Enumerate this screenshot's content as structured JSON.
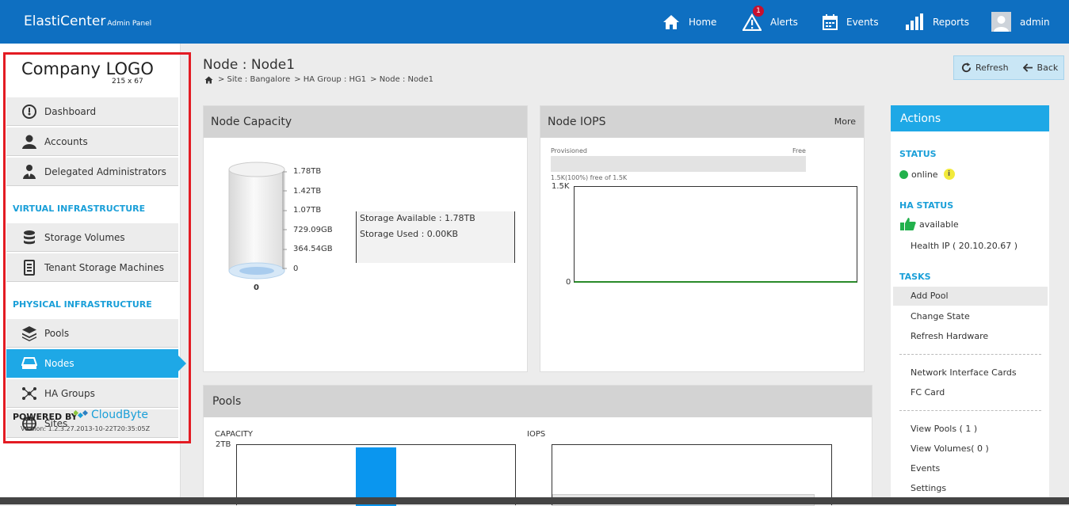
{
  "header": {
    "brand": "ElastiCenter",
    "brand_sub": "Admin Panel",
    "nav": [
      {
        "label": "Home",
        "icon": "home-icon"
      },
      {
        "label": "Alerts",
        "icon": "alert-icon",
        "badge": "1"
      },
      {
        "label": "Events",
        "icon": "calendar-icon"
      },
      {
        "label": "Reports",
        "icon": "bar-chart-icon"
      },
      {
        "label": "admin",
        "icon": "user-avatar-icon"
      }
    ]
  },
  "sidebar": {
    "logo": "Company LOGO",
    "logo_size": "215 x 67",
    "items": [
      {
        "label": "Dashboard",
        "icon": "dashboard-icon"
      },
      {
        "label": "Accounts",
        "icon": "user-icon"
      },
      {
        "label": "Delegated Administrators",
        "icon": "admin-icon"
      }
    ],
    "section_virtual": "VIRTUAL INFRASTRUCTURE",
    "virtual_items": [
      {
        "label": "Storage Volumes",
        "icon": "database-icon"
      },
      {
        "label": "Tenant Storage Machines",
        "icon": "server-icon"
      }
    ],
    "section_physical": "PHYSICAL INFRASTRUCTURE",
    "physical_items": [
      {
        "label": "Pools",
        "icon": "layers-icon"
      },
      {
        "label": "Nodes",
        "icon": "drive-icon",
        "active": true
      },
      {
        "label": "HA Groups",
        "icon": "network-icon"
      },
      {
        "label": "Sites",
        "icon": "globe-icon"
      }
    ],
    "powered_by": "POWERED BY",
    "powered_brand": "CloudByte",
    "version": "Version: 1.2.3.27.2013-10-22T20:35:05Z"
  },
  "page": {
    "title": "Node : Node1",
    "breadcrumb": [
      "> Site : Bangalore",
      "> HA Group : HG1",
      "> Node : Node1"
    ],
    "refresh_label": "Refresh",
    "back_label": "Back"
  },
  "capacity": {
    "title": "Node Capacity",
    "ticks": [
      "1.78TB",
      "1.42TB",
      "1.07TB",
      "729.09GB",
      "364.54GB",
      "0"
    ],
    "bottom_label": "0",
    "available": "Storage Available : 1.78TB",
    "used": "Storage Used : 0.00KB"
  },
  "iops": {
    "title": "Node IOPS",
    "more": "More",
    "provisioned": "Provisioned",
    "free": "Free",
    "free_note": "1.5K(100%) free of 1.5K",
    "ymax": "1.5K",
    "ymin": "0"
  },
  "pools": {
    "title": "Pools",
    "capacity_label": "CAPACITY",
    "capacity_tick": "2TB",
    "iops_label": "IOPS"
  },
  "actions": {
    "title": "Actions",
    "status_head": "STATUS",
    "status_value": "online",
    "ha_head": "HA STATUS",
    "ha_value": "available",
    "health_ip": "Health IP ( 20.10.20.67 )",
    "tasks_head": "TASKS",
    "tasks": [
      "Add Pool",
      "Change State",
      "Refresh Hardware"
    ],
    "tasks2": [
      "Network Interface Cards",
      "FC Card"
    ],
    "tasks3": [
      "View Pools ( 1 )",
      "View Volumes( 0 )",
      "Events",
      "Settings"
    ]
  },
  "colors": {
    "header": "#0e6fc1",
    "accent": "#1ea8e6",
    "online": "#22b14c"
  }
}
